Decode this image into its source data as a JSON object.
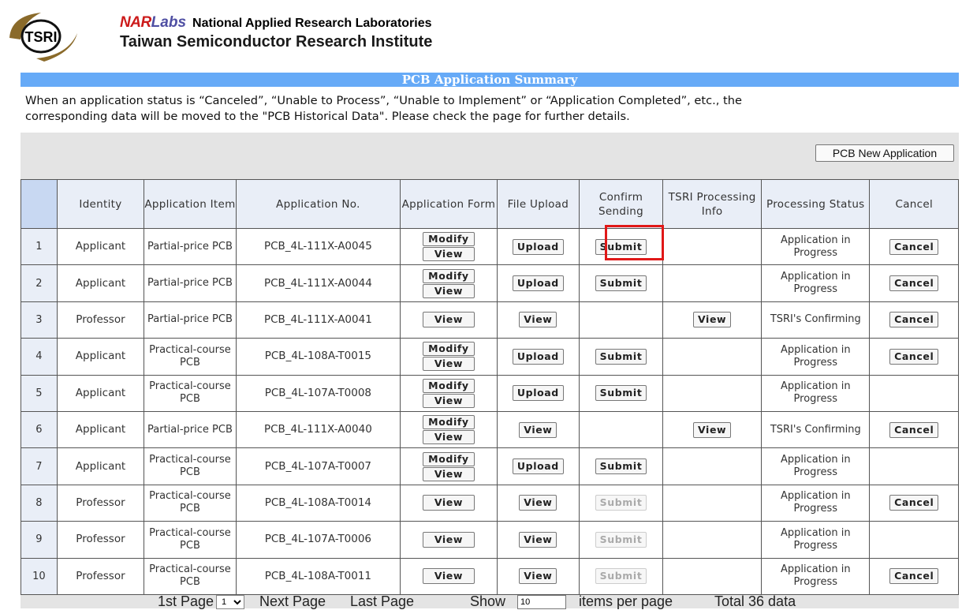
{
  "header": {
    "logo_text": "TSRI",
    "nar": "NAR",
    "labs": "Labs",
    "org_name": "National Applied Research Laboratories",
    "institute": "Taiwan Semiconductor Research Institute"
  },
  "summary": {
    "title": "PCB Application Summary",
    "notice_line1": "When an application status is “Canceled”, “Unable to Process”, “Unable to Implement” or “Application Completed”, etc., the",
    "notice_line2": "corresponding data will be moved to the \"PCB Historical Data\". Please check the page for further details."
  },
  "toolbar": {
    "new_application_label": "PCB New Application"
  },
  "table": {
    "headers": {
      "identity": "Identity",
      "item": "Application Item",
      "number": "Application No.",
      "form": "Application Form",
      "upload": "File Upload",
      "confirm": "Confirm Sending",
      "tsri": "TSRI Processing Info",
      "status": "Processing Status",
      "cancel": "Cancel"
    },
    "buttons": {
      "modify": "Modify",
      "view": "View",
      "upload": "Upload",
      "submit": "Submit",
      "cancel": "Cancel"
    },
    "rows": [
      {
        "idx": "1",
        "identity": "Applicant",
        "item": "Partial-price PCB",
        "number": "PCB_4L-111X-A0045",
        "status": "Application in Progress"
      },
      {
        "idx": "2",
        "identity": "Applicant",
        "item": "Partial-price PCB",
        "number": "PCB_4L-111X-A0044",
        "status": "Application in Progress"
      },
      {
        "idx": "3",
        "identity": "Professor",
        "item": "Partial-price PCB",
        "number": "PCB_4L-111X-A0041",
        "status": "TSRI's Confirming"
      },
      {
        "idx": "4",
        "identity": "Applicant",
        "item": "Practical-course PCB",
        "number": "PCB_4L-108A-T0015",
        "status": "Application in Progress"
      },
      {
        "idx": "5",
        "identity": "Applicant",
        "item": "Practical-course PCB",
        "number": "PCB_4L-107A-T0008",
        "status": "Application in Progress"
      },
      {
        "idx": "6",
        "identity": "Applicant",
        "item": "Partial-price PCB",
        "number": "PCB_4L-111X-A0040",
        "status": "TSRI's Confirming"
      },
      {
        "idx": "7",
        "identity": "Applicant",
        "item": "Practical-course PCB",
        "number": "PCB_4L-107A-T0007",
        "status": "Application in Progress"
      },
      {
        "idx": "8",
        "identity": "Professor",
        "item": "Practical-course PCB",
        "number": "PCB_4L-108A-T0014",
        "status": "Application in Progress"
      },
      {
        "idx": "9",
        "identity": "Professor",
        "item": "Practical-course PCB",
        "number": "PCB_4L-107A-T0006",
        "status": "Application in Progress"
      },
      {
        "idx": "10",
        "identity": "Professor",
        "item": "Practical-course PCB",
        "number": "PCB_4L-108A-T0011",
        "status": "Application in Progress"
      }
    ]
  },
  "pager": {
    "first": "1st Page",
    "page_value": "1",
    "next": "Next Page",
    "last": "Last Page",
    "show": "Show",
    "per_page_value": "10",
    "per_page_suffix": "items per page",
    "total": "Total 36 data"
  },
  "colors": {
    "summary_bar": "#66aaf7",
    "highlight": "#e01818",
    "nar_red": "#cc1a1a"
  }
}
